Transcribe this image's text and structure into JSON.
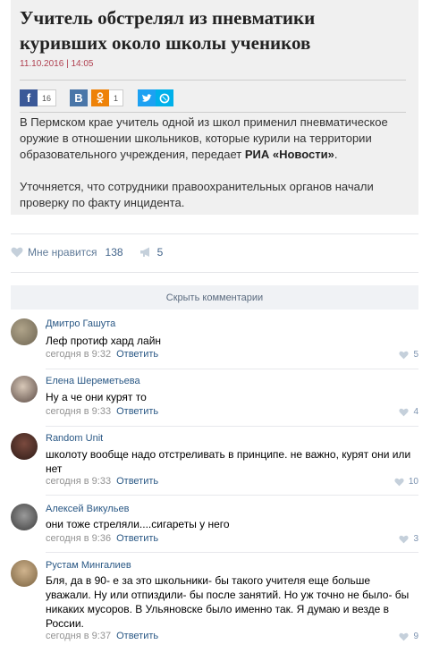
{
  "article": {
    "title": "Учитель обстрелял из пневматики куривших около школы учеников",
    "date": "11.10.2016 | 14:05",
    "share": {
      "facebook_icon": "facebook-icon",
      "facebook_count": "16",
      "vk_icon": "vk-icon",
      "ok_icon": "odnoklassniki-icon",
      "ok_count": "1",
      "twitter_icon": "twitter-icon",
      "livejournal_icon": "livejournal-icon"
    },
    "paragraph1_text": "В Пермском крае учитель одной из школ применил пневматическое оружие в отношении школьников, которые курили на территории образовательного учреждения, передает",
    "paragraph1_bold": "РИА «Новости»",
    "paragraph1_end": ".",
    "paragraph2": "Уточняется, что сотрудники правоохранительных органов начали проверку по факту инцидента."
  },
  "reactions": {
    "like_label": "Мне нравится",
    "like_count": "138",
    "share_count": "5"
  },
  "hide_comments_label": "Скрыть комментарии",
  "comments": [
    {
      "name": "Дмитро Гашута",
      "text": "Леф протиф хард лайн",
      "time": "сегодня в 9:32",
      "reply": "Ответить",
      "likes": "5"
    },
    {
      "name": "Елена Шереметьева",
      "text": "Ну а че они курят то",
      "time": "сегодня в 9:33",
      "reply": "Ответить",
      "likes": "4"
    },
    {
      "name": "Random Unit",
      "text": "школоту вообще надо отстреливать в принципе. не важно, курят они или нет",
      "time": "сегодня в 9:33",
      "reply": "Ответить",
      "likes": "10"
    },
    {
      "name": "Алексей Викульев",
      "text": "они тоже стреляли....сигареты у него",
      "time": "сегодня в 9:36",
      "reply": "Ответить",
      "likes": "3"
    },
    {
      "name": "Рустам Мингалиев",
      "text": "Бля, да в 90- е за это школьники- бы такого учителя еще больше уважали. Ну или отпиздили- бы после занятий. Но уж точно не было- бы никаких мусоров. В Ульяновске было именно так. Я думаю и везде в России.",
      "time": "сегодня в 9:37",
      "reply": "Ответить",
      "likes": "9"
    }
  ],
  "colors": {
    "link": "#2a5885",
    "date": "#b04050",
    "facebook": "#3b5998",
    "vk": "#4a76a8",
    "ok": "#ee8208",
    "twitter": "#1da1f2",
    "livejournal": "#00b0ea"
  }
}
